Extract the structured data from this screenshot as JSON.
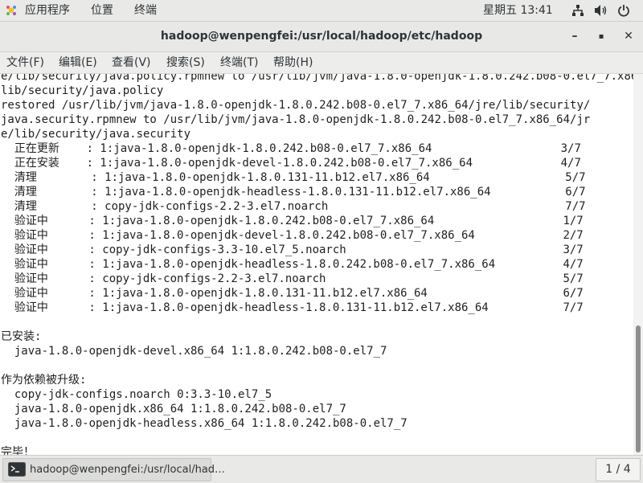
{
  "topbar": {
    "apps_label": "应用程序",
    "places_label": "位置",
    "terminal_label": "终端",
    "clock": "星期五 13:41"
  },
  "window": {
    "title": "hadoop@wenpengfei:/usr/local/hadoop/etc/hadoop",
    "minimize": "–",
    "maximize": "▪",
    "close": "✕"
  },
  "menubar": {
    "items": [
      "文件(F)",
      "编辑(E)",
      "查看(V)",
      "搜索(S)",
      "终端(T)",
      "帮助(H)"
    ]
  },
  "terminal": {
    "lines": [
      "e/lib/security/java.policy.rpmnew to /usr/lib/jvm/java-1.8.0-openjdk-1.8.0.242.b08-0.el7_7.x86_64/jr",
      "lib/security/java.policy",
      "restored /usr/lib/jvm/java-1.8.0-openjdk-1.8.0.242.b08-0.el7_7.x86_64/jre/lib/security/",
      "java.security.rpmnew to /usr/lib/jvm/java-1.8.0-openjdk-1.8.0.242.b08-0.el7_7.x86_64/jr",
      "e/lib/security/java.security",
      "  正在更新    : 1:java-1.8.0-openjdk-1.8.0.242.b08-0.el7_7.x86_64                   3/7",
      "  正在安装    : 1:java-1.8.0-openjdk-devel-1.8.0.242.b08-0.el7_7.x86_64             4/7",
      "  清理        : 1:java-1.8.0-openjdk-1.8.0.131-11.b12.el7.x86_64                    5/7",
      "  清理        : 1:java-1.8.0-openjdk-headless-1.8.0.131-11.b12.el7.x86_64           6/7",
      "  清理        : copy-jdk-configs-2.2-3.el7.noarch                                   7/7",
      "  验证中      : 1:java-1.8.0-openjdk-1.8.0.242.b08-0.el7_7.x86_64                   1/7",
      "  验证中      : 1:java-1.8.0-openjdk-devel-1.8.0.242.b08-0.el7_7.x86_64             2/7",
      "  验证中      : copy-jdk-configs-3.3-10.el7_5.noarch                                3/7",
      "  验证中      : 1:java-1.8.0-openjdk-headless-1.8.0.242.b08-0.el7_7.x86_64          4/7",
      "  验证中      : copy-jdk-configs-2.2-3.el7.noarch                                   5/7",
      "  验证中      : 1:java-1.8.0-openjdk-1.8.0.131-11.b12.el7.x86_64                    6/7",
      "  验证中      : 1:java-1.8.0-openjdk-headless-1.8.0.131-11.b12.el7.x86_64           7/7",
      "",
      "已安装:",
      "  java-1.8.0-openjdk-devel.x86_64 1:1.8.0.242.b08-0.el7_7",
      "",
      "作为依赖被升级:",
      "  copy-jdk-configs.noarch 0:3.3-10.el7_5",
      "  java-1.8.0-openjdk.x86_64 1:1.8.0.242.b08-0.el7_7",
      "  java-1.8.0-openjdk-headless.x86_64 1:1.8.0.242.b08-0.el7_7",
      "",
      "完毕！"
    ]
  },
  "taskbar": {
    "task_label": "hadoop@wenpengfei:/usr/local/had…",
    "workspace": "1 / 4"
  },
  "colors": {
    "panel_bg": "#e9e9e7",
    "terminal_bg": "#ffffff",
    "terminal_fg": "#1f1f1f",
    "scroll_thumb": "#8d8f8d"
  }
}
